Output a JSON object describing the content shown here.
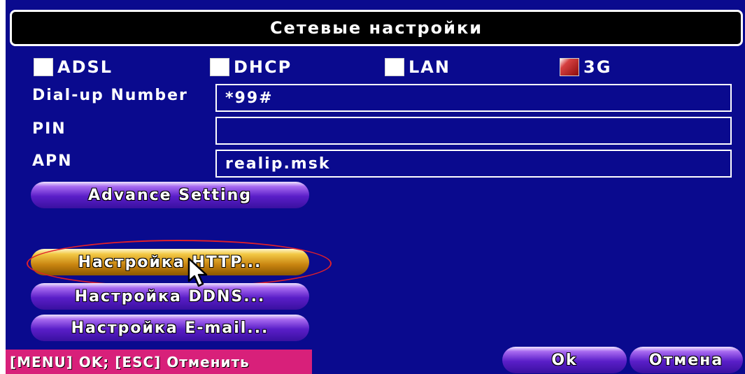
{
  "window": {
    "title": "Сетевые настройки"
  },
  "connection_types": [
    {
      "label": "ADSL",
      "checked": false
    },
    {
      "label": "DHCP",
      "checked": false
    },
    {
      "label": "LAN",
      "checked": false
    },
    {
      "label": "3G",
      "checked": true
    }
  ],
  "fields": {
    "dialup": {
      "label": "Dial-up Number",
      "value": "*99#"
    },
    "pin": {
      "label": "PIN",
      "value": ""
    },
    "apn": {
      "label": "APN",
      "value": "realip.msk"
    }
  },
  "buttons": {
    "advance": "Advance Setting",
    "http": "Настройка HTTP...",
    "ddns": "Настройка DDNS...",
    "email": "Настройка E-mail...",
    "ok": "Ok",
    "cancel": "Отмена"
  },
  "status": {
    "hint": "[MENU] OK; [ESC] Отменить"
  },
  "colors": {
    "background": "#0a0a8e",
    "button": "#5a1ec8",
    "button_active": "#c88410",
    "checkbox_on": "#8c0d0d",
    "status_bar": "#d8207a",
    "highlight": "#e0202a"
  },
  "icons": {
    "cursor": "mouse-pointer-icon"
  }
}
